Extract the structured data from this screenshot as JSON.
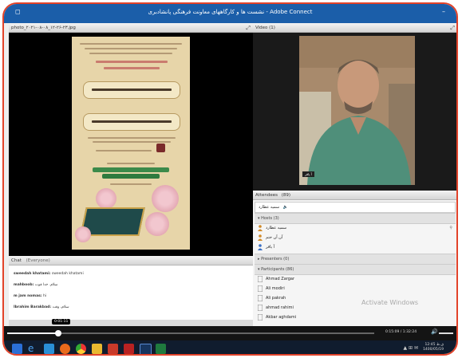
{
  "window": {
    "title": "نشست ها و کارگاههای معاونت فرهنگی پانشادبری - Adobe Connect",
    "minimize": "–",
    "maximize": "◻"
  },
  "share_pod": {
    "title": "photo_۲۰۲۱-۰۸-۰۸_۱۲-۲۶-۲۳.jpg"
  },
  "video_pod": {
    "title": "Video (1)",
    "speaker_tag": "آ یاقر"
  },
  "chat_pod": {
    "title": "Chat",
    "scope": "(Everyone)",
    "messages": [
      {
        "sender": "sweedah khatami:",
        "text": "sweedah khatami"
      },
      {
        "sender": "mahboob:",
        "text": "سلام. خدا قوت"
      },
      {
        "sender": "m jam nomas:",
        "text": "hi"
      },
      {
        "sender": "Ibrahim Barakbad:",
        "text": "سلام، وقت"
      }
    ]
  },
  "attendees_pod": {
    "title": "Attendees",
    "count": "(89)",
    "active_speakers_label": "سمیه عطارد",
    "sections": {
      "hosts": "▾ Hosts (3)",
      "presenters": "▸ Presenters (0)",
      "participants": "▾ Participants (86)"
    },
    "hosts": [
      "سمیه عطارد",
      "آن آن ختم",
      "آ یاقر"
    ],
    "participants": [
      "Ahmad Zargar",
      "Ali modiri",
      "Ali pakrah",
      "ahmad rahimi",
      "Akbar aghdami"
    ]
  },
  "watermark": "Activate Windows",
  "seekbar": {
    "tooltip": "0:01:11",
    "time": "0:15:09 / 1:32:24"
  },
  "taskbar": {
    "time": "12:45 ق.ظ",
    "date": "1400/05/19"
  },
  "colors": {
    "title_bar": "#1b5ea9",
    "border": "#e2432a",
    "taskbar": "#101c2e",
    "chat_bg": "#ffffff",
    "attendees_bg": "#f5f5f5"
  }
}
